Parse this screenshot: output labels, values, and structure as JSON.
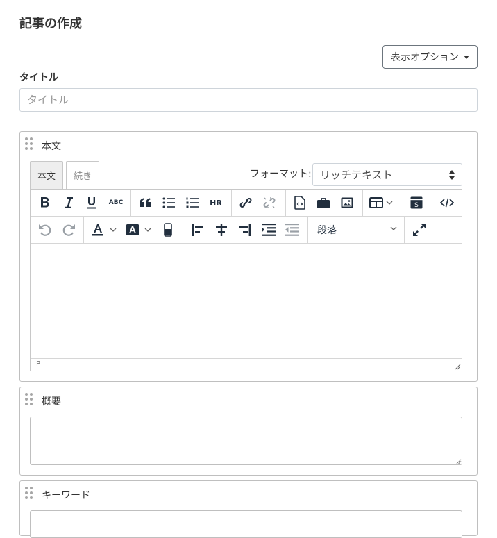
{
  "page": {
    "title": "記事の作成"
  },
  "display_options": {
    "label": "表示オプション"
  },
  "title_field": {
    "label": "タイトル",
    "placeholder": "タイトル",
    "value": ""
  },
  "body_panel": {
    "label": "本文",
    "tabs": [
      {
        "label": "本文",
        "active": true
      },
      {
        "label": "続き",
        "active": false
      }
    ],
    "format": {
      "label": "フォーマット:",
      "selected": "リッチテキスト"
    },
    "toolbar": {
      "row1": [
        "bold-icon",
        "italic-icon",
        "underline-icon",
        "strikethrough-icon",
        "blockquote-icon",
        "bullet-list-icon",
        "numbered-list-icon",
        "horizontal-rule-icon",
        "link-icon",
        "unlink-icon",
        "insert-file-icon",
        "insert-asset-icon",
        "insert-image-icon",
        "table-icon",
        "template-icon",
        "source-code-icon"
      ],
      "row2": [
        "undo-icon",
        "redo-icon",
        "text-color-icon",
        "background-color-icon",
        "remove-format-icon",
        "align-left-icon",
        "align-center-icon",
        "align-right-icon",
        "indent-icon",
        "outdent-icon",
        "fullscreen-icon"
      ],
      "hr_label": "HR",
      "abc_label": "ABC",
      "block_format": "段落"
    },
    "status_path": "P",
    "content": ""
  },
  "summary_panel": {
    "label": "概要",
    "value": ""
  },
  "keyword_panel": {
    "label": "キーワード",
    "value": ""
  },
  "colors": {
    "text": "#333333",
    "border": "#bfbfbf",
    "toolbar_icon": "#222f3e",
    "disabled_icon": "#8a8a8a",
    "tab_active_bg": "#eeeeee"
  }
}
